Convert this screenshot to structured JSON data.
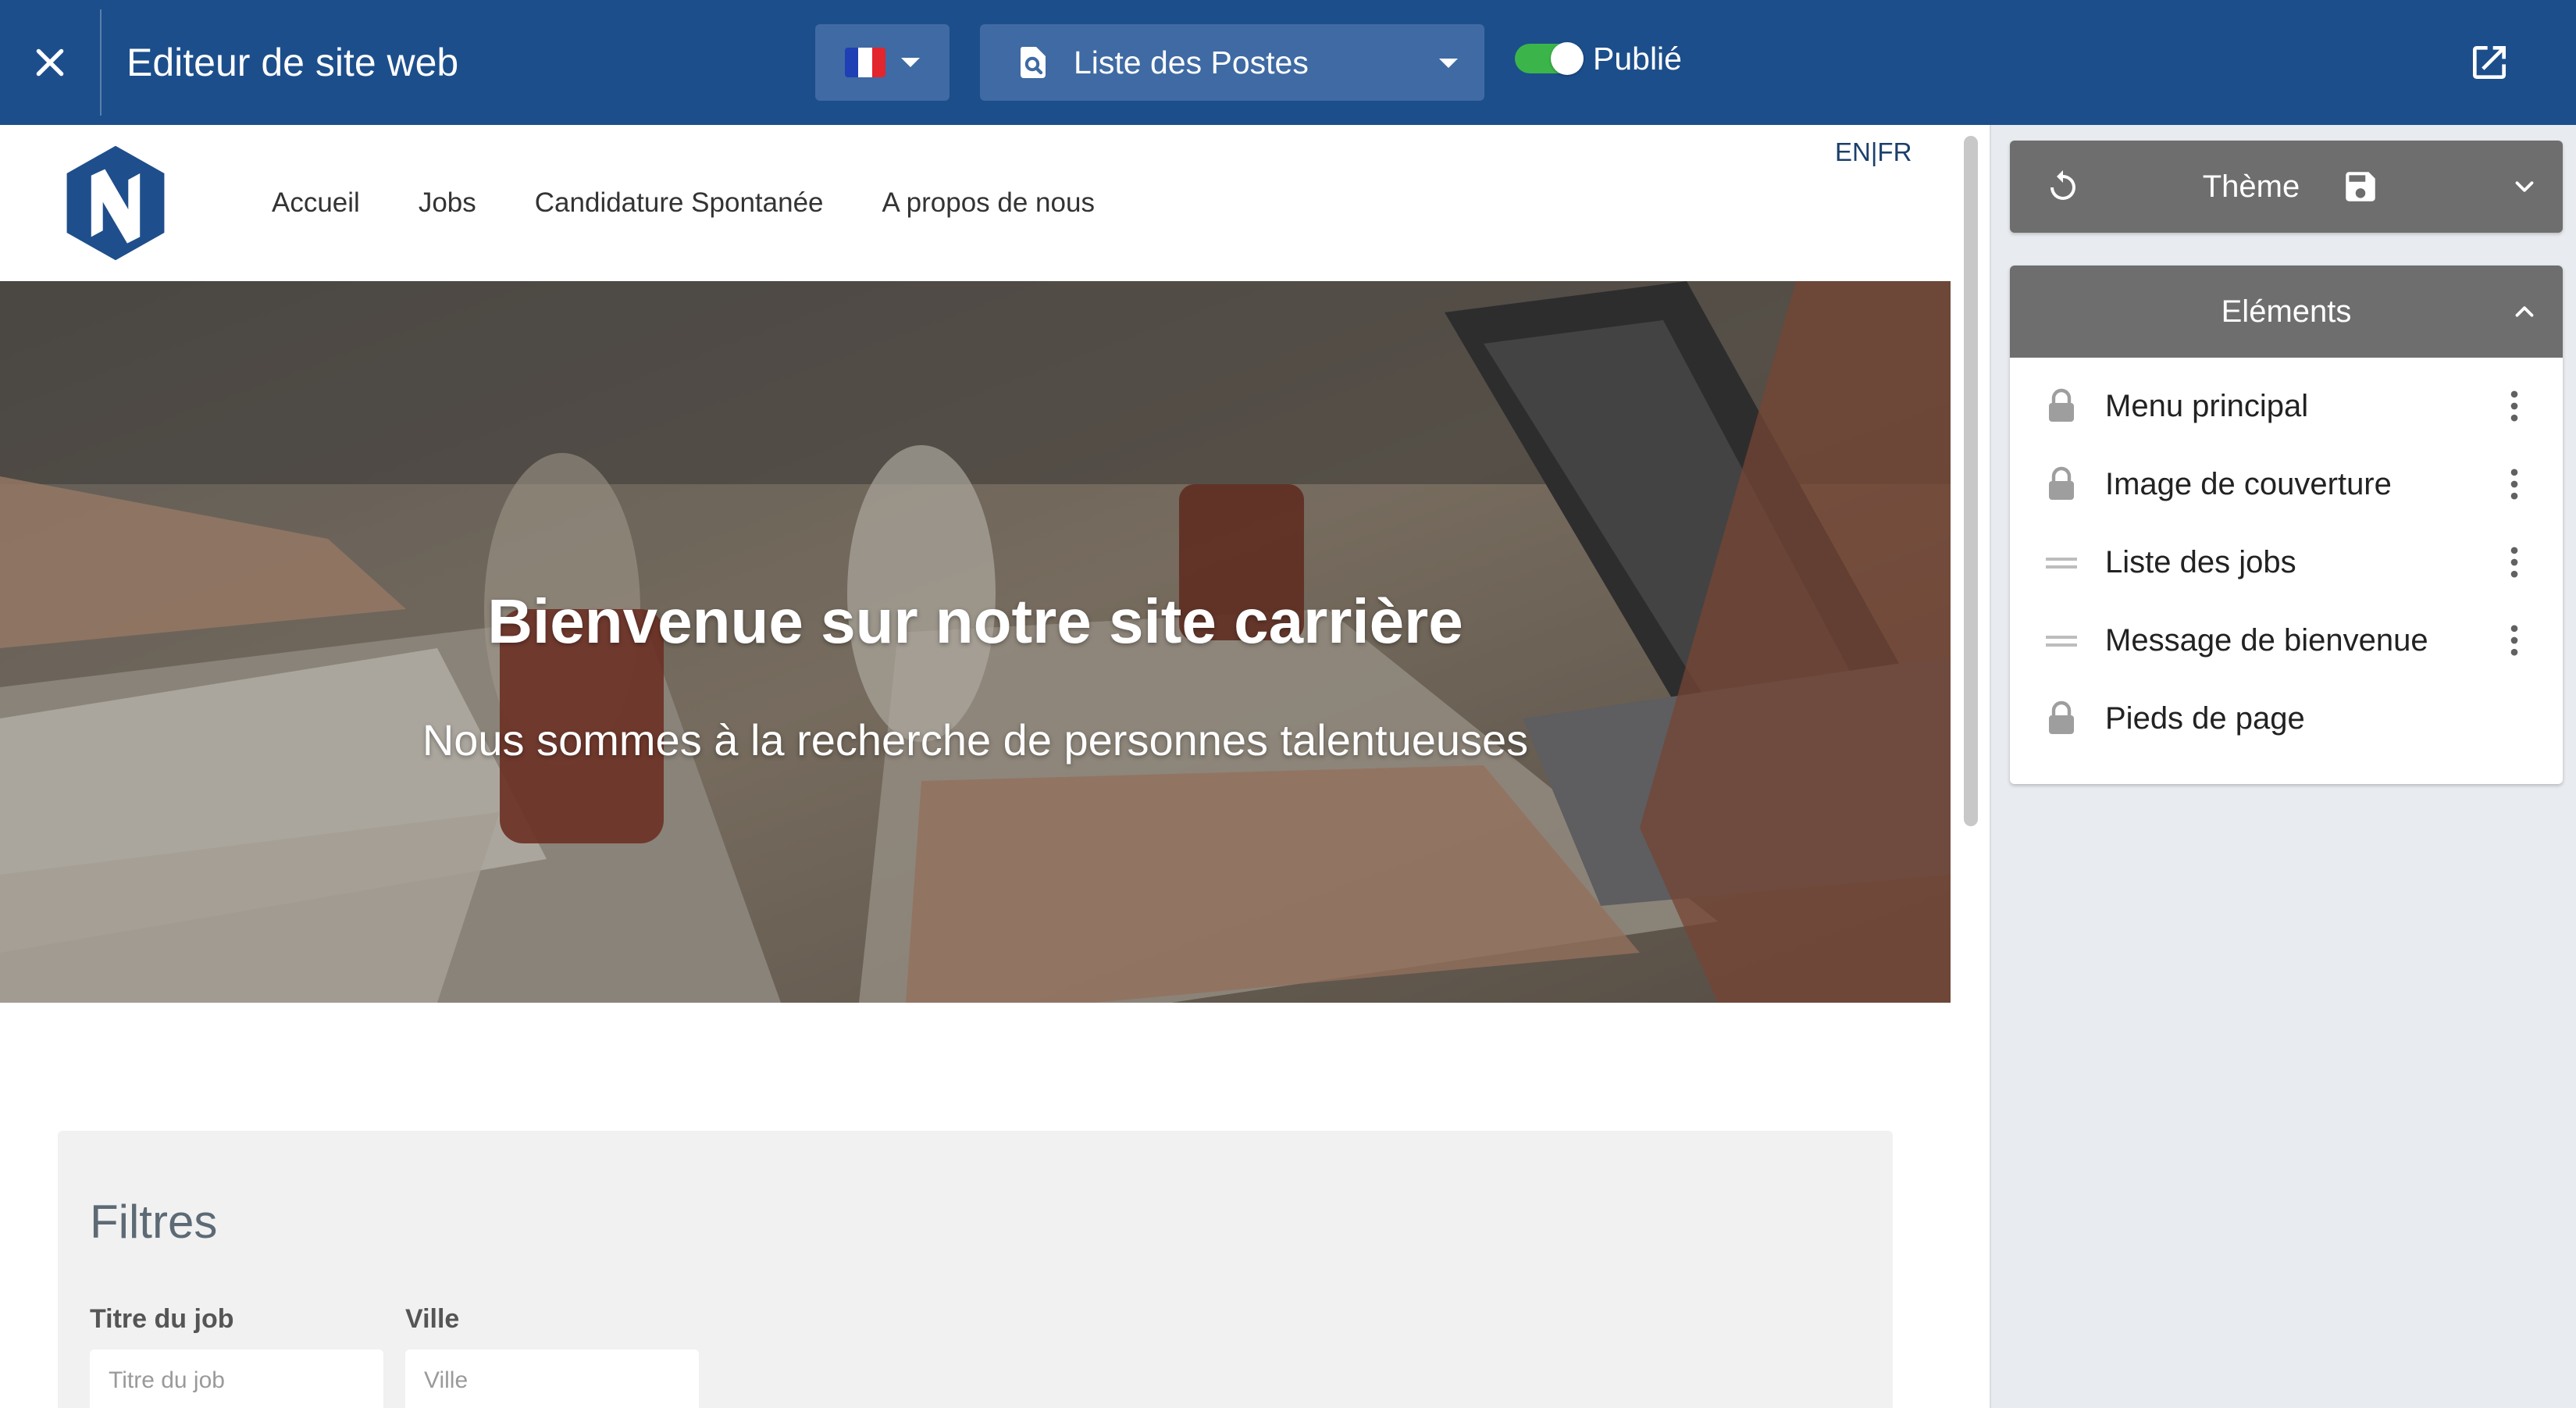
{
  "topbar": {
    "title": "Editeur de site web",
    "language_flag": "fr-flag-icon",
    "page_select": "Liste des Postes",
    "published_label": "Publié",
    "published": true,
    "colors": {
      "background": "#1c4e8b",
      "select_bg": "#3f6aa3",
      "toggle_on": "#3bb54a"
    }
  },
  "site": {
    "nav": [
      "Accueil",
      "Jobs",
      "Candidature Spontanée",
      "A propos de nous"
    ],
    "lang_switch": {
      "en": "EN",
      "separator": "|",
      "fr": "FR"
    },
    "hero": {
      "title": "Bienvenue sur notre site carrière",
      "subtitle": "Nous sommes à la recherche de personnes talentueuses"
    },
    "filters": {
      "title": "Filtres",
      "job_title_label": "Titre du job",
      "job_title_placeholder": "Titre du job",
      "city_label": "Ville",
      "city_placeholder": "Ville"
    },
    "brand_color": "#1f4e8c"
  },
  "panel": {
    "theme_label": "Thème",
    "elements_label": "Eléments",
    "elements": [
      {
        "label": "Menu principal",
        "icon": "lock-icon",
        "has_menu": true
      },
      {
        "label": "Image de couverture",
        "icon": "lock-icon",
        "has_menu": true
      },
      {
        "label": "Liste des jobs",
        "icon": "drag-handle-icon",
        "has_menu": true
      },
      {
        "label": "Message de bienvenue",
        "icon": "drag-handle-icon",
        "has_menu": true
      },
      {
        "label": "Pieds de page",
        "icon": "lock-icon",
        "has_menu": false
      }
    ]
  }
}
